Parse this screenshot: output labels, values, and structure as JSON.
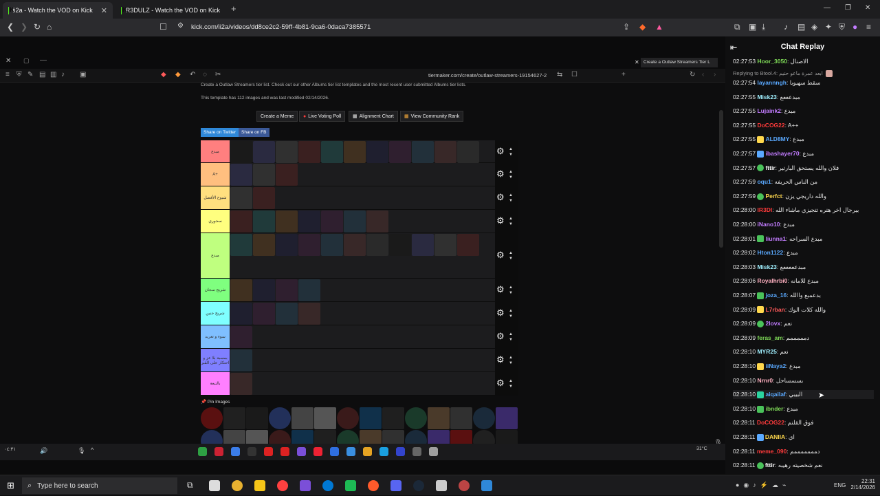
{
  "browser": {
    "tabs": [
      {
        "title": "ii2a - Watch the VOD on Kick",
        "active": true
      },
      {
        "title": "R3DULZ - Watch the VOD on Kick",
        "active": false
      }
    ],
    "url": "kick.com/ii2a/videos/dd8ce2c2-59ff-4b81-9ca6-0daca7385571"
  },
  "inner_browser": {
    "tab_title": "Create a Outlaw Streamers Tier L",
    "url": "tiermaker.com/create/outlaw-streamers-19154627-2"
  },
  "tierpage": {
    "intro": "Create a Outlaw Streamers tier list. Check out our other Albums tier list templates and the most recent user submitted Albums tier lists.",
    "info": "This template has 112 images and was last modified 02/14/2026.",
    "buttons": [
      "Create a Meme",
      "Live Voting Poll",
      "Alignment Chart",
      "View Community Rank"
    ],
    "share": [
      "Share on Twitter",
      "Share on FB"
    ],
    "pin_label": "Pin Images",
    "rows": [
      {
        "label": "مبدع",
        "color": "#ff7f7f",
        "tiles": 11
      },
      {
        "label": "A+",
        "color": "#ffbf7f",
        "tiles": 3
      },
      {
        "label": "شبوح الأفضل",
        "color": "#ffdf7f",
        "tiles": 2
      },
      {
        "label": "سجوري",
        "color": "#ffff7f",
        "tiles": 7
      },
      {
        "label": "مبدع",
        "color": "#bfff7f",
        "tiles": 11
      },
      {
        "label": "شريج سجان",
        "color": "#7fff7f",
        "tiles": 4
      },
      {
        "label": "شريج جنين",
        "color": "#7fffff",
        "tiles": 4
      },
      {
        "label": "سوء و تعريد",
        "color": "#7fbfff",
        "tiles": 1
      },
      {
        "label": "بمسبة بلا عز و احتكار على القبر",
        "color": "#7f7fff",
        "tiles": 1
      },
      {
        "label": "بالتبعة",
        "color": "#ff7fff",
        "tiles": 1
      }
    ]
  },
  "chat": {
    "title": "Chat Replay",
    "messages": [
      {
        "time": "02:27:53",
        "user": "Hoor_3050",
        "color": "#7ed957",
        "text": "الاصنال"
      },
      {
        "time": "",
        "user": "",
        "color": "#aaaaaa",
        "text": "Replying to Btool.4: ابعد عمرة ماعو حتيم"
      },
      {
        "time": "02:27:54",
        "user": "layannngh",
        "color": "#5aa9ff",
        "text": "سقط سهيوبا"
      },
      {
        "time": "02:27:55",
        "user": "Misk23",
        "color": "#a0f0ff",
        "text": "مبدعععع"
      },
      {
        "time": "02:27:55",
        "user": "Lujaink2",
        "color": "#c27cff",
        "text": "مبدع"
      },
      {
        "time": "02:27:55",
        "user": "DoCOG22",
        "color": "#ff3b3b",
        "text": "A++"
      },
      {
        "time": "02:27:55",
        "user": "ALD8MY",
        "color": "#5aa9ff",
        "text": "مبدع"
      },
      {
        "time": "02:27:57",
        "user": "ibashayer70",
        "color": "#c27cff",
        "text": "مبدع"
      },
      {
        "time": "02:27:57",
        "user": "fttir",
        "color": "#ffffff",
        "text": "فلان والله يستحق البارتير"
      },
      {
        "time": "02:27:59",
        "user": "oqu1",
        "color": "#5aa9ff",
        "text": "من الناس الحريفه"
      },
      {
        "time": "02:27:59",
        "user": "Perfct",
        "color": "#ffd84d",
        "text": "والله داريجي يزن"
      },
      {
        "time": "02:28:00",
        "user": "IR3DI",
        "color": "#ff3b3b",
        "text": "بيرجال اخر هتره تتجيزي ماشاء الله"
      },
      {
        "time": "02:28:00",
        "user": "iNano10",
        "color": "#c27cff",
        "text": "مبدع"
      },
      {
        "time": "02:28:01",
        "user": "liunna1",
        "color": "#c27cff",
        "text": "مبدع السراحه"
      },
      {
        "time": "02:28:02",
        "user": "Hton1122",
        "color": "#5aa9ff",
        "text": "مبدع"
      },
      {
        "time": "02:28:03",
        "user": "Misk23",
        "color": "#a0f0ff",
        "text": "مبدعععععع"
      },
      {
        "time": "02:28:06",
        "user": "Royalhrbi0",
        "color": "#ffb0c0",
        "text": "مبدع للامانه"
      },
      {
        "time": "02:28:07",
        "user": "joza_16",
        "color": "#5aa9ff",
        "text": "بدعمبع واالله"
      },
      {
        "time": "02:28:09",
        "user": "L7rban",
        "color": "#ff5a5a",
        "text": "والله كلات الوك"
      },
      {
        "time": "02:28:09",
        "user": "2lovx",
        "color": "#c27cff",
        "text": "نعم"
      },
      {
        "time": "02:28:09",
        "user": "feras_am",
        "color": "#7ed957",
        "text": "دمممممم"
      },
      {
        "time": "02:28:10",
        "user": "MYR25",
        "color": "#a0f0ff",
        "text": "نعم"
      },
      {
        "time": "02:28:10",
        "user": "iiNaya2",
        "color": "#5aa9ff",
        "text": "مبدع"
      },
      {
        "time": "02:28:10",
        "user": "Nrnr0",
        "color": "#ffb0c0",
        "text": "بسسساحل"
      },
      {
        "time": "02:28:10",
        "user": "aiqailaf",
        "color": "#5aa9ff",
        "text": "البيبي"
      },
      {
        "time": "02:28:10",
        "user": "ibnder",
        "color": "#7ed957",
        "text": "مبدع"
      },
      {
        "time": "02:28:11",
        "user": "DoCOG22",
        "color": "#ff3b3b",
        "text": "فوق القلنم"
      },
      {
        "time": "02:28:11",
        "user": "DANIIA",
        "color": "#ffd84d",
        "text": "اي"
      },
      {
        "time": "02:28:11",
        "user": "meme_090",
        "color": "#ff3b3b",
        "text": "دمممممممم"
      },
      {
        "time": "02:28:11",
        "user": "fttir",
        "color": "#ffffff",
        "text": "نعم شخصيته رهيبه"
      }
    ]
  },
  "taskbar": {
    "search_placeholder": "Type here to search",
    "time": "22:31",
    "date": "2/14/2026",
    "lang": "ENG"
  },
  "stream_tray": {
    "weather": "31°C",
    "clock": "٠٤:٣١"
  }
}
